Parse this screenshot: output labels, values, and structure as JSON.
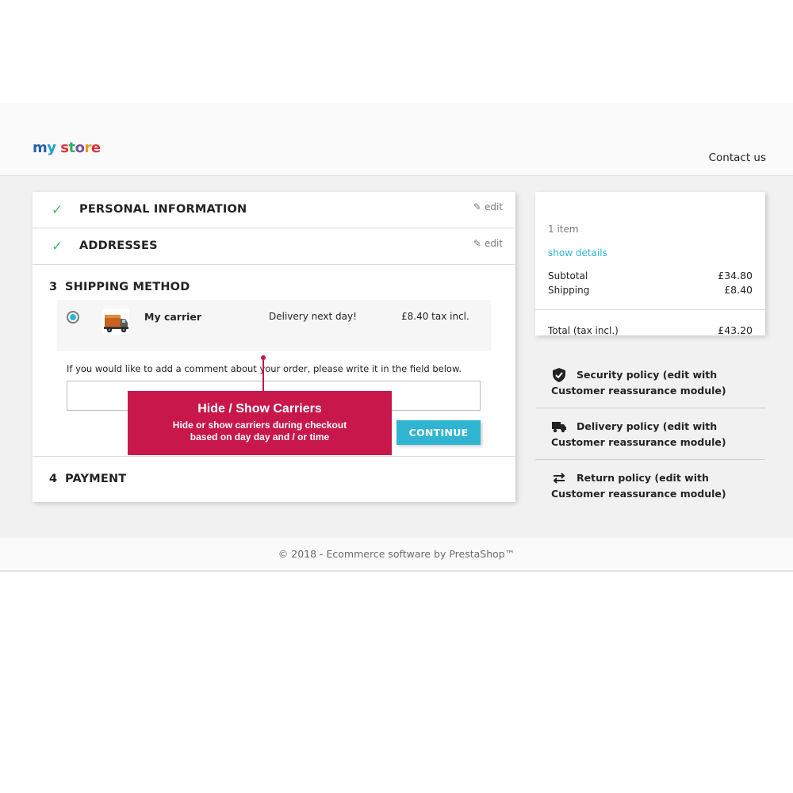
{
  "header": {
    "logo": {
      "letters": [
        "m",
        "y",
        " ",
        "s",
        "t",
        "o",
        "r",
        "e"
      ],
      "colors": [
        "#2a5fa8",
        "#23a0c9",
        "",
        "#e0323c",
        "#35aa5a",
        "#7a4fa0",
        "#e49a1f",
        "#e0323c"
      ]
    },
    "contact_label": "Contact us"
  },
  "checkout": {
    "steps": [
      {
        "number": "",
        "title": "PERSONAL INFORMATION",
        "done": true,
        "edit_label": "edit"
      },
      {
        "number": "",
        "title": "ADDRESSES",
        "done": true,
        "edit_label": "edit"
      },
      {
        "number": "3",
        "title": "SHIPPING METHOD",
        "done": false
      },
      {
        "number": "4",
        "title": "PAYMENT",
        "done": false
      }
    ],
    "carrier": {
      "name": "My carrier",
      "delay": "Delivery next day!",
      "price": "£8.40 tax incl.",
      "selected": true,
      "icon": "truck-icon"
    },
    "comment_label": "If you would like to add a comment about your order, please write it in the field below.",
    "comment_value": "",
    "continue_label": "CONTINUE"
  },
  "callout": {
    "title": "Hide / Show Carriers",
    "line1": "Hide or show carriers during checkout",
    "line2": "based on day day and / or time",
    "color": "#c8174b"
  },
  "summary": {
    "items_count": "1 item",
    "show_details": "show details",
    "subtotal_label": "Subtotal",
    "subtotal_value": "£34.80",
    "shipping_label": "Shipping",
    "shipping_value": "£8.40",
    "total_label": "Total (tax incl.)",
    "total_value": "£43.20"
  },
  "reassurance": [
    {
      "icon": "shield-icon",
      "text": "Security policy (edit with Customer reassurance module)"
    },
    {
      "icon": "truck-icon",
      "text": "Delivery policy (edit with Customer reassurance module)"
    },
    {
      "icon": "swap-arrows-icon",
      "text": "Return policy (edit with Customer reassurance module)"
    }
  ],
  "footer": {
    "text": "© 2018 - Ecommerce software by PrestaShop™"
  },
  "colors": {
    "accent": "#2fb5d2",
    "check": "#4cbb6c",
    "background": "#f1f1f1"
  }
}
